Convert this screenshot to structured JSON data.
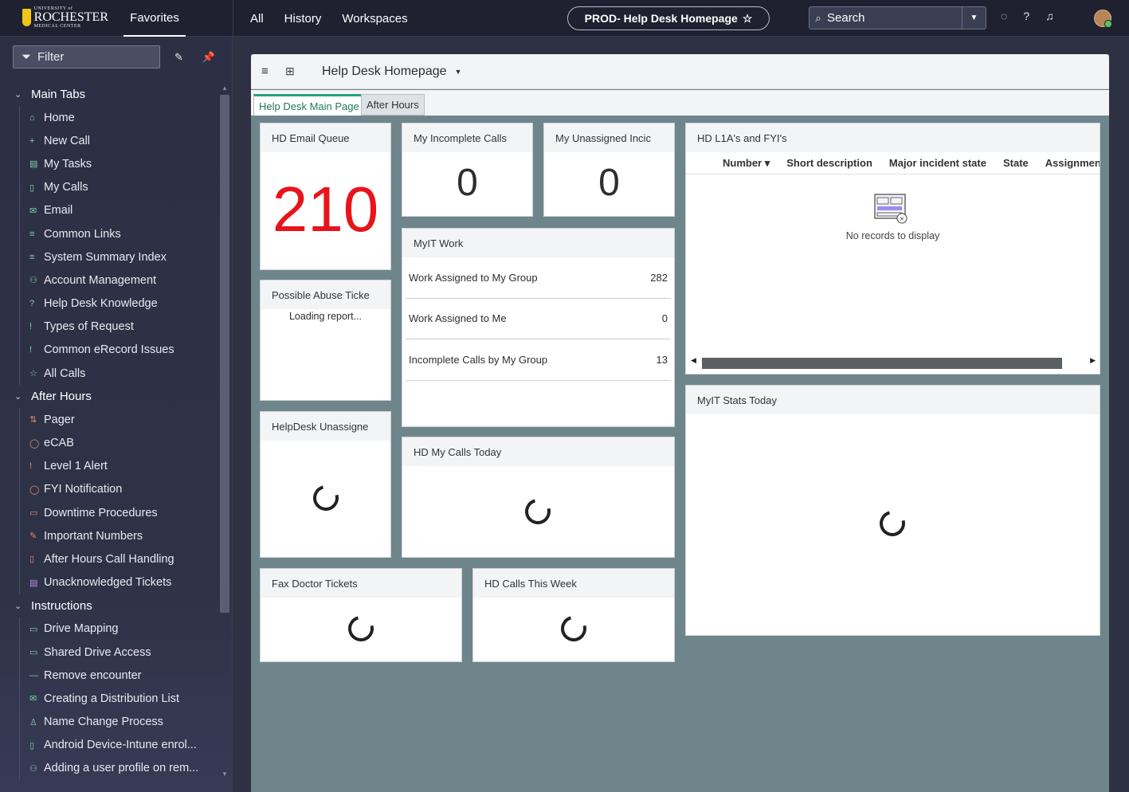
{
  "topbar": {
    "logo": {
      "line1": "UNIVERSITY of",
      "line2": "ROCHESTER",
      "line3": "MEDICAL CENTER"
    },
    "favorites_label": "Favorites",
    "nav": [
      "All",
      "History",
      "Workspaces"
    ],
    "context_title": "PROD- Help Desk Homepage",
    "context_star": "☆",
    "search_placeholder": "Search",
    "icons": [
      "chat-icon",
      "help-icon",
      "bell-icon"
    ]
  },
  "sidebar": {
    "filter_label": "Filter",
    "sections": [
      {
        "label": "Main Tabs",
        "items": [
          {
            "label": "Home",
            "icon": "⌂"
          },
          {
            "label": "New Call",
            "icon": "+"
          },
          {
            "label": "My Tasks",
            "icon": "▤"
          },
          {
            "label": "My Calls",
            "icon": "▯"
          },
          {
            "label": "Email",
            "icon": "✉"
          },
          {
            "label": "Common Links",
            "icon": "≡"
          },
          {
            "label": "System Summary Index",
            "icon": "≡"
          },
          {
            "label": "Account Management",
            "icon": "⚇"
          },
          {
            "label": "Help Desk Knowledge",
            "icon": "?"
          },
          {
            "label": "Types of Request",
            "icon": "!"
          },
          {
            "label": "Common eRecord Issues",
            "icon": "!"
          },
          {
            "label": "All Calls",
            "icon": "☆"
          }
        ]
      },
      {
        "label": "After Hours",
        "items": [
          {
            "label": "Pager",
            "icon": "⇅",
            "color": "orange"
          },
          {
            "label": "eCAB",
            "icon": "◯",
            "color": "orange"
          },
          {
            "label": "Level 1 Alert",
            "icon": "!",
            "color": "orange"
          },
          {
            "label": "FYI Notification",
            "icon": "◯",
            "color": "orange"
          },
          {
            "label": "Downtime Procedures",
            "icon": "▭",
            "color": "orange"
          },
          {
            "label": "Important Numbers",
            "icon": "✎",
            "color": "orange"
          },
          {
            "label": "After Hours Call Handling",
            "icon": "▯",
            "color": "orange"
          },
          {
            "label": "Unacknowledged Tickets",
            "icon": "▤",
            "color": "purple"
          }
        ]
      },
      {
        "label": "Instructions",
        "items": [
          {
            "label": "Drive Mapping",
            "icon": "▭"
          },
          {
            "label": "Shared Drive Access",
            "icon": "▭"
          },
          {
            "label": "Remove encounter",
            "icon": "—"
          },
          {
            "label": "Creating a Distribution List",
            "icon": "✉"
          },
          {
            "label": "Name Change Process",
            "icon": "♙"
          },
          {
            "label": "Android Device-Intune enrol...",
            "icon": "▯"
          },
          {
            "label": "Adding a user profile on rem...",
            "icon": "⚇"
          }
        ]
      }
    ]
  },
  "main": {
    "title": "Help Desk Homepage",
    "tabs": [
      "Help Desk Main Page",
      "After Hours"
    ],
    "widgets": {
      "email_queue": {
        "title": "HD Email Queue",
        "value": "210",
        "value_color": "#e8141b"
      },
      "incomplete_calls": {
        "title": "My Incomplete Calls",
        "value": "0"
      },
      "unassigned_incidents": {
        "title": "My Unassigned Incic",
        "value": "0"
      },
      "possible_abuse": {
        "title": "Possible Abuse Ticke",
        "status": "Loading report..."
      },
      "myit_work": {
        "title": "MyIT Work",
        "rows": [
          {
            "label": "Work Assigned to My Group",
            "count": "282"
          },
          {
            "label": "Work Assigned to Me",
            "count": "0"
          },
          {
            "label": "Incomplete Calls by My Group",
            "count": "13"
          }
        ]
      },
      "l1a_fyi": {
        "title": "HD L1A's and FYI's",
        "columns": [
          "Number ▾",
          "Short description",
          "Major incident state",
          "State",
          "Assignment gr"
        ],
        "empty": "No records to display"
      },
      "helpdesk_unassigned": {
        "title": "HelpDesk Unassigne"
      },
      "my_calls_today": {
        "title": "HD My Calls Today"
      },
      "myit_stats_today": {
        "title": "MyIT Stats Today"
      },
      "fax_doctor": {
        "title": "Fax Doctor Tickets"
      },
      "calls_this_week": {
        "title": "HD Calls This Week"
      }
    }
  }
}
